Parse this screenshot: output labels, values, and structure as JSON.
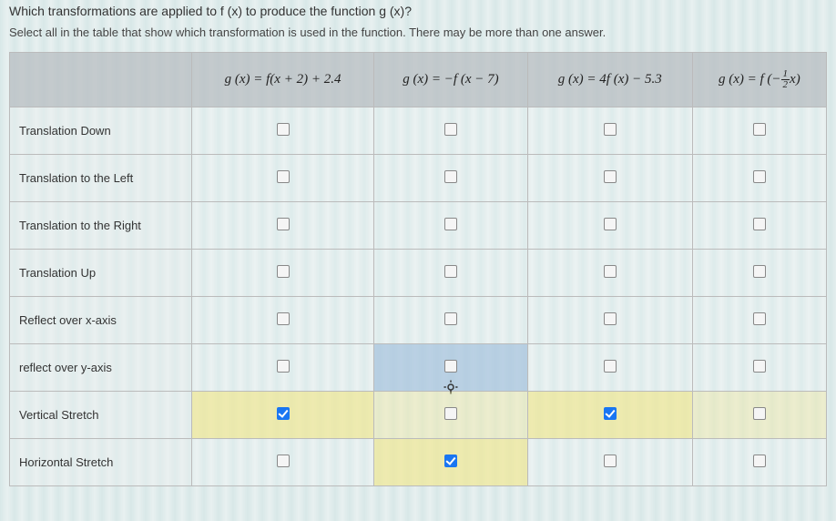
{
  "question": "Which transformations are applied to f (x) to produce the function g (x)?",
  "instruction": "Select all in the table that show which transformation is used in the function.  There may be more than one answer.",
  "columns": {
    "c1": "g (x) = f(x + 2) + 2.4",
    "c2": "g (x) = −f (x − 7)",
    "c3": "g (x) = 4f (x) − 5.3",
    "c4": "g (x) = f (−½x)"
  },
  "rows": {
    "r1": "Translation Down",
    "r2": "Translation to the Left",
    "r3": "Translation to the Right",
    "r4": "Translation Up",
    "r5": "Reflect over x-axis",
    "r6": "reflect over y-axis",
    "r7": "Vertical Stretch",
    "r8": "Horizontal Stretch"
  },
  "checked": {
    "r7c1": true,
    "r7c3": true,
    "r8c2": true
  },
  "highlights": {
    "r6c2": "blue",
    "r7c1": "yellow",
    "r7c2": "yellow-light",
    "r7c3": "yellow",
    "r7c4": "yellow-light",
    "r8c2": "yellow"
  }
}
